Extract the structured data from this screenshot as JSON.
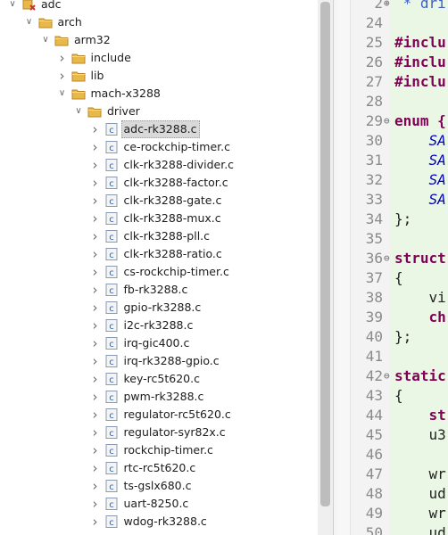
{
  "tree": {
    "rows": [
      {
        "depth": 0,
        "twisty": "expanded",
        "icon": "project",
        "label": "adc"
      },
      {
        "depth": 1,
        "twisty": "expanded",
        "icon": "folder",
        "label": "arch"
      },
      {
        "depth": 2,
        "twisty": "expanded",
        "icon": "folder",
        "label": "arm32"
      },
      {
        "depth": 3,
        "twisty": "collapsed",
        "icon": "folder",
        "label": "include"
      },
      {
        "depth": 3,
        "twisty": "collapsed",
        "icon": "folder",
        "label": "lib"
      },
      {
        "depth": 3,
        "twisty": "expanded",
        "icon": "folder",
        "label": "mach-x3288"
      },
      {
        "depth": 4,
        "twisty": "expanded",
        "icon": "folder",
        "label": "driver"
      },
      {
        "depth": 5,
        "twisty": "collapsed",
        "icon": "cfile",
        "label": "adc-rk3288.c",
        "selected": true
      },
      {
        "depth": 5,
        "twisty": "collapsed",
        "icon": "cfile",
        "label": "ce-rockchip-timer.c",
        "hover": true
      },
      {
        "depth": 5,
        "twisty": "collapsed",
        "icon": "cfile",
        "label": "clk-rk3288-divider.c"
      },
      {
        "depth": 5,
        "twisty": "collapsed",
        "icon": "cfile",
        "label": "clk-rk3288-factor.c"
      },
      {
        "depth": 5,
        "twisty": "collapsed",
        "icon": "cfile",
        "label": "clk-rk3288-gate.c"
      },
      {
        "depth": 5,
        "twisty": "collapsed",
        "icon": "cfile",
        "label": "clk-rk3288-mux.c"
      },
      {
        "depth": 5,
        "twisty": "collapsed",
        "icon": "cfile",
        "label": "clk-rk3288-pll.c"
      },
      {
        "depth": 5,
        "twisty": "collapsed",
        "icon": "cfile",
        "label": "clk-rk3288-ratio.c"
      },
      {
        "depth": 5,
        "twisty": "collapsed",
        "icon": "cfile",
        "label": "cs-rockchip-timer.c"
      },
      {
        "depth": 5,
        "twisty": "collapsed",
        "icon": "cfile",
        "label": "fb-rk3288.c"
      },
      {
        "depth": 5,
        "twisty": "collapsed",
        "icon": "cfile",
        "label": "gpio-rk3288.c"
      },
      {
        "depth": 5,
        "twisty": "collapsed",
        "icon": "cfile",
        "label": "i2c-rk3288.c"
      },
      {
        "depth": 5,
        "twisty": "collapsed",
        "icon": "cfile",
        "label": "irq-gic400.c"
      },
      {
        "depth": 5,
        "twisty": "collapsed",
        "icon": "cfile",
        "label": "irq-rk3288-gpio.c"
      },
      {
        "depth": 5,
        "twisty": "collapsed",
        "icon": "cfile",
        "label": "key-rc5t620.c"
      },
      {
        "depth": 5,
        "twisty": "collapsed",
        "icon": "cfile",
        "label": "pwm-rk3288.c"
      },
      {
        "depth": 5,
        "twisty": "collapsed",
        "icon": "cfile",
        "label": "regulator-rc5t620.c"
      },
      {
        "depth": 5,
        "twisty": "collapsed",
        "icon": "cfile",
        "label": "regulator-syr82x.c"
      },
      {
        "depth": 5,
        "twisty": "collapsed",
        "icon": "cfile",
        "label": "rockchip-timer.c"
      },
      {
        "depth": 5,
        "twisty": "collapsed",
        "icon": "cfile",
        "label": "rtc-rc5t620.c"
      },
      {
        "depth": 5,
        "twisty": "collapsed",
        "icon": "cfile",
        "label": "ts-gslx680.c"
      },
      {
        "depth": 5,
        "twisty": "collapsed",
        "icon": "cfile",
        "label": "uart-8250.c"
      },
      {
        "depth": 5,
        "twisty": "collapsed",
        "icon": "cfile",
        "label": "wdog-rk3288.c"
      }
    ]
  },
  "editor": {
    "lines": [
      {
        "num": "2",
        "fold": "⊕",
        "text": " * dri",
        "style": "cm"
      },
      {
        "num": "24",
        "fold": "",
        "text": "",
        "style": ""
      },
      {
        "num": "25",
        "fold": "",
        "text": "#inclu",
        "style": "kw"
      },
      {
        "num": "26",
        "fold": "",
        "text": "#inclu",
        "style": "kw"
      },
      {
        "num": "27",
        "fold": "",
        "text": "#inclu",
        "style": "kw"
      },
      {
        "num": "28",
        "fold": "",
        "text": "",
        "style": ""
      },
      {
        "num": "29",
        "fold": "⊖",
        "text": "enum {",
        "style": "kw"
      },
      {
        "num": "30",
        "fold": "",
        "text": "    SA",
        "style": "it"
      },
      {
        "num": "31",
        "fold": "",
        "text": "    SA",
        "style": "it"
      },
      {
        "num": "32",
        "fold": "",
        "text": "    SA",
        "style": "it"
      },
      {
        "num": "33",
        "fold": "",
        "text": "    SA",
        "style": "it"
      },
      {
        "num": "34",
        "fold": "",
        "text": "};",
        "style": ""
      },
      {
        "num": "35",
        "fold": "",
        "text": "",
        "style": ""
      },
      {
        "num": "36",
        "fold": "⊖",
        "text": "struct",
        "style": "kw"
      },
      {
        "num": "37",
        "fold": "",
        "text": "{",
        "style": ""
      },
      {
        "num": "38",
        "fold": "",
        "text": "    vi",
        "style": ""
      },
      {
        "num": "39",
        "fold": "",
        "text": "    ch",
        "style": "kw"
      },
      {
        "num": "40",
        "fold": "",
        "text": "};",
        "style": ""
      },
      {
        "num": "41",
        "fold": "",
        "text": "",
        "style": ""
      },
      {
        "num": "42",
        "fold": "⊖",
        "text": "static",
        "style": "kw"
      },
      {
        "num": "43",
        "fold": "",
        "text": "{",
        "style": ""
      },
      {
        "num": "44",
        "fold": "",
        "text": "    st",
        "style": "kw"
      },
      {
        "num": "45",
        "fold": "",
        "text": "    u3",
        "style": ""
      },
      {
        "num": "46",
        "fold": "",
        "text": "",
        "style": ""
      },
      {
        "num": "47",
        "fold": "",
        "text": "    wr",
        "style": ""
      },
      {
        "num": "48",
        "fold": "",
        "text": "    ud",
        "style": ""
      },
      {
        "num": "49",
        "fold": "",
        "text": "    wr",
        "style": ""
      },
      {
        "num": "50",
        "fold": "",
        "text": "    ud",
        "style": ""
      }
    ]
  }
}
